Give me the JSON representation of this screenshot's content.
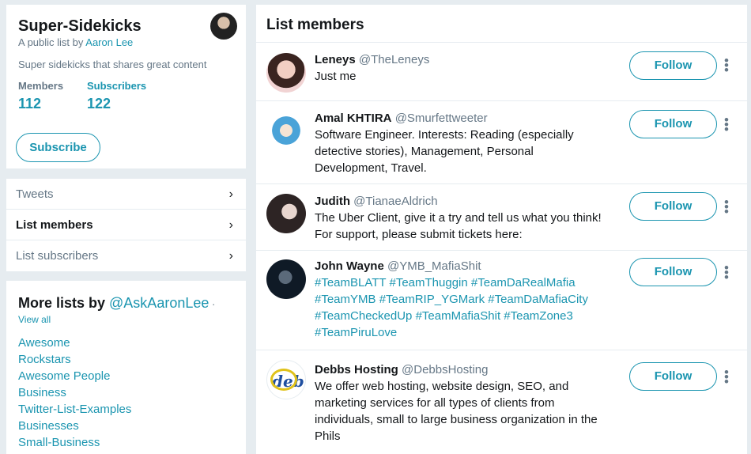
{
  "list": {
    "title": "Super-Sidekicks",
    "byline_prefix": "A public list by ",
    "owner": "Aaron Lee",
    "description": "Super sidekicks that shares great content",
    "members_label": "Members",
    "members_count": "112",
    "subscribers_label": "Subscribers",
    "subscribers_count": "122",
    "subscribe_label": "Subscribe"
  },
  "nav": {
    "items": [
      {
        "label": "Tweets"
      },
      {
        "label": "List members"
      },
      {
        "label": "List subscribers"
      }
    ]
  },
  "more_lists": {
    "heading_prefix": "More lists by ",
    "handle": "@AskAaronLee",
    "separator": "·",
    "view_all": "View all",
    "items": [
      "Awesome",
      "Rockstars",
      "Awesome People",
      "Business",
      "Twitter-List-Examples",
      "Businesses",
      "Small-Business"
    ]
  },
  "members": {
    "title": "List members",
    "follow_label": "Follow",
    "items": [
      {
        "name": "Leneys",
        "handle": "@TheLeneys",
        "bio": "Just me",
        "avatar_color": "#e9b7b7"
      },
      {
        "name": "Amal KHTIRA",
        "handle": "@Smurfettweeter",
        "bio": "Software Engineer. Interests: Reading (especially detective stories), Management, Personal Development, Travel.",
        "avatar_color": "#4aa3d8"
      },
      {
        "name": "Judith",
        "handle": "@TianaeAldrich",
        "bio": "The Uber Client, give it a try and tell us what you think! For support, please submit tickets here:",
        "avatar_color": "#3b3434"
      },
      {
        "name": "John Wayne",
        "handle": "@YMB_MafiaShit",
        "bio": "#TeamBLATT #TeamThuggin #TeamDaRealMafia #TeamYMB #TeamRIP_YGMark #TeamDaMafiaCity #TeamCheckedUp #TeamMafiaShit #TeamZone3 #TeamPiruLove",
        "avatar_color": "#1a2a3c"
      },
      {
        "name": "Debbs Hosting",
        "handle": "@DebbsHosting",
        "bio": "We offer web hosting, website design, SEO, and marketing services for all types of clients from individuals, small to large business organization in the Phils",
        "avatar_color": "#1f4fa0"
      }
    ]
  }
}
